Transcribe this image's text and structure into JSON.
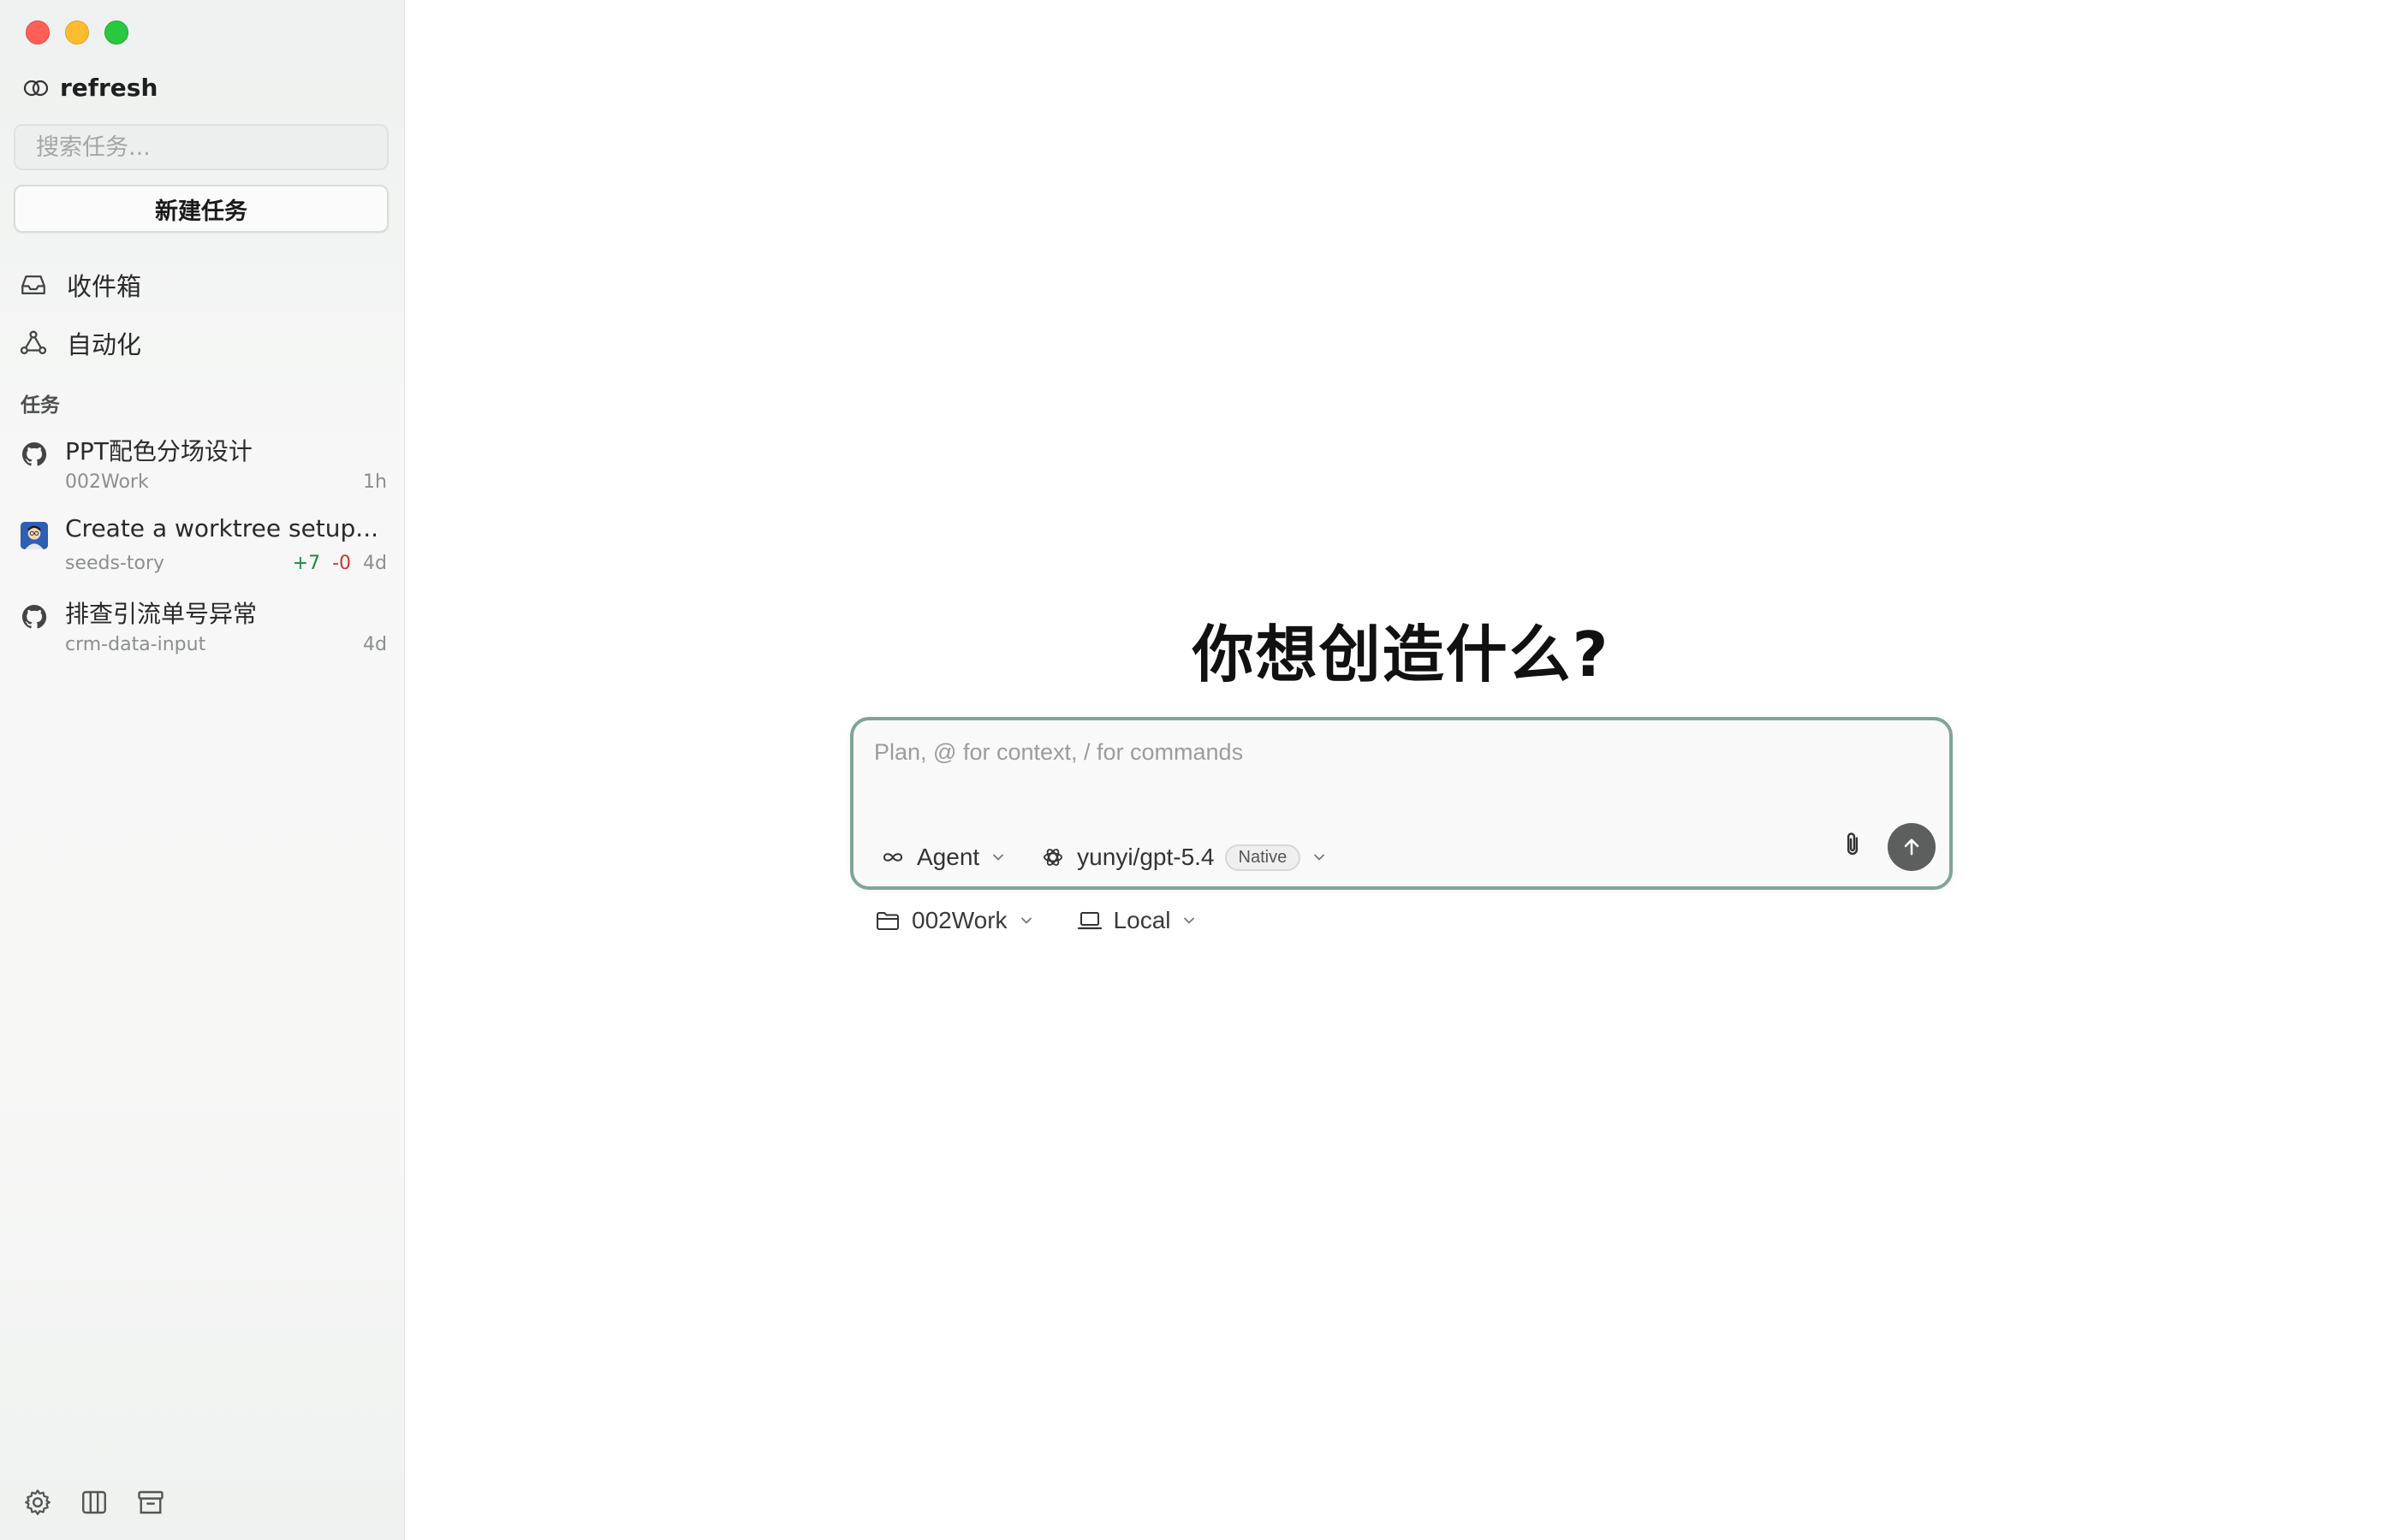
{
  "window": {
    "controls": [
      "close",
      "minimize",
      "zoom"
    ]
  },
  "sidebar": {
    "workspace": {
      "icon": "two-rings-icon",
      "name": "refresh"
    },
    "search": {
      "placeholder": "搜索任务...",
      "value": ""
    },
    "new_task_label": "新建任务",
    "nav": [
      {
        "icon": "inbox-icon",
        "label": "收件箱"
      },
      {
        "icon": "automation-icon",
        "label": "自动化"
      }
    ],
    "section_title": "任务",
    "tasks": [
      {
        "icon": "github-icon",
        "title": "PPT配色分场设计",
        "repo": "002Work",
        "added": "",
        "removed": "",
        "age": "1h"
      },
      {
        "icon": "avatar-icon",
        "title": "Create a worktree setup...",
        "repo": "seeds-tory",
        "added": "+7",
        "removed": "-0",
        "age": "4d"
      },
      {
        "icon": "github-icon",
        "title": "排查引流单号异常",
        "repo": "crm-data-input",
        "age": "4d"
      }
    ],
    "footer_icons": [
      "settings-icon",
      "columns-icon",
      "archive-icon"
    ]
  },
  "main": {
    "headline": "你想创造什么?",
    "composer": {
      "placeholder": "Plan, @ for context, / for commands",
      "value": "",
      "mode": {
        "icon": "infinity-icon",
        "label": "Agent"
      },
      "model": {
        "icon": "openai-icon",
        "label": "yunyi/gpt-5.4",
        "badge": "Native"
      },
      "attach_icon": "paperclip-icon",
      "send_icon": "arrow-up-icon"
    },
    "context": {
      "folder": {
        "icon": "folder-icon",
        "label": "002Work"
      },
      "env": {
        "icon": "laptop-icon",
        "label": "Local"
      }
    }
  },
  "colors": {
    "composer_border": "#7fa595",
    "send_button": "#5c5f5e",
    "added": "#1f8a3a",
    "removed": "#d0342c",
    "close": "#ff5f57",
    "minimize": "#febc2e",
    "zoom": "#28c840"
  }
}
